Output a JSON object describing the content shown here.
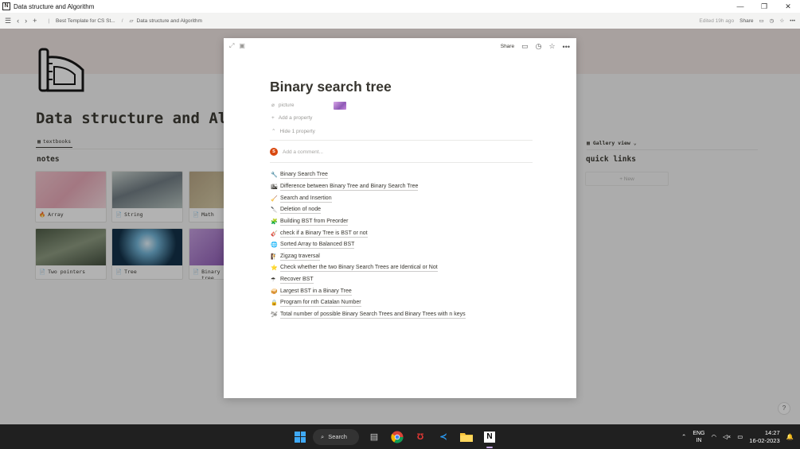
{
  "window": {
    "app_icon": "N",
    "title": "Data structure and Algorithm",
    "controls": [
      "—",
      "❐",
      "✕"
    ]
  },
  "topbar": {
    "nav_icons": [
      "menu-icon",
      "back-icon",
      "forward-icon",
      "add-icon"
    ],
    "breadcrumb_1": "Best Template for CS St...",
    "breadcrumb_2": "Data structure and Algorithm",
    "edited": "Edited 19h ago",
    "share": "Share"
  },
  "background_page": {
    "title": "Data structure and Alg",
    "view_tab": "textbooks",
    "notes_heading": "notes",
    "cards": [
      {
        "label": "Array",
        "icon": "🔥"
      },
      {
        "label": "String",
        "icon": "📄"
      },
      {
        "label": "Math",
        "icon": "📄"
      },
      {
        "label": "Two pointers",
        "icon": "📄"
      },
      {
        "label": "Tree",
        "icon": "📄"
      },
      {
        "label": "Binary tree",
        "icon": "📄"
      }
    ],
    "gallery_view": "Gallery view",
    "quick_links_heading": "quick links",
    "new_button": "+ New",
    "help": "?"
  },
  "modal": {
    "share": "Share",
    "title": "Binary search tree",
    "property_picture": "picture",
    "add_property": "Add a property",
    "hide_property": "Hide 1 property",
    "comment_placeholder": "Add a comment...",
    "avatar_initial": "S",
    "links": [
      {
        "emoji": "🔧",
        "text": "Binary Search Tree"
      },
      {
        "emoji": "🏙",
        "text": "Difference between Binary Tree and Binary Search Tree"
      },
      {
        "emoji": "🧹",
        "text": "Search and Insertion"
      },
      {
        "emoji": "🔪",
        "text": "Deletion of node"
      },
      {
        "emoji": "🧩",
        "text": "Building BST from Preorder"
      },
      {
        "emoji": "🎸",
        "text": "check if a Binary Tree is BST or not"
      },
      {
        "emoji": "🌐",
        "text": "Sorted Array to Balanced BST"
      },
      {
        "emoji": "🧗",
        "text": "Zigzag traversal"
      },
      {
        "emoji": "⭐",
        "text": "Check whether the two Binary Search Trees are Identical or Not"
      },
      {
        "emoji": "☂",
        "text": "Recover BST"
      },
      {
        "emoji": "🥪",
        "text": "Largest BST in a Binary Tree"
      },
      {
        "emoji": "🔒",
        "text": "Program for nth Catalan Number"
      },
      {
        "emoji": "🛩",
        "text": "Total number of possible Binary Search Trees and Binary Trees with n keys"
      }
    ]
  },
  "taskbar": {
    "search": "Search",
    "lang_1": "ENG",
    "lang_2": "IN",
    "time": "14:27",
    "date": "16-02-2023"
  }
}
